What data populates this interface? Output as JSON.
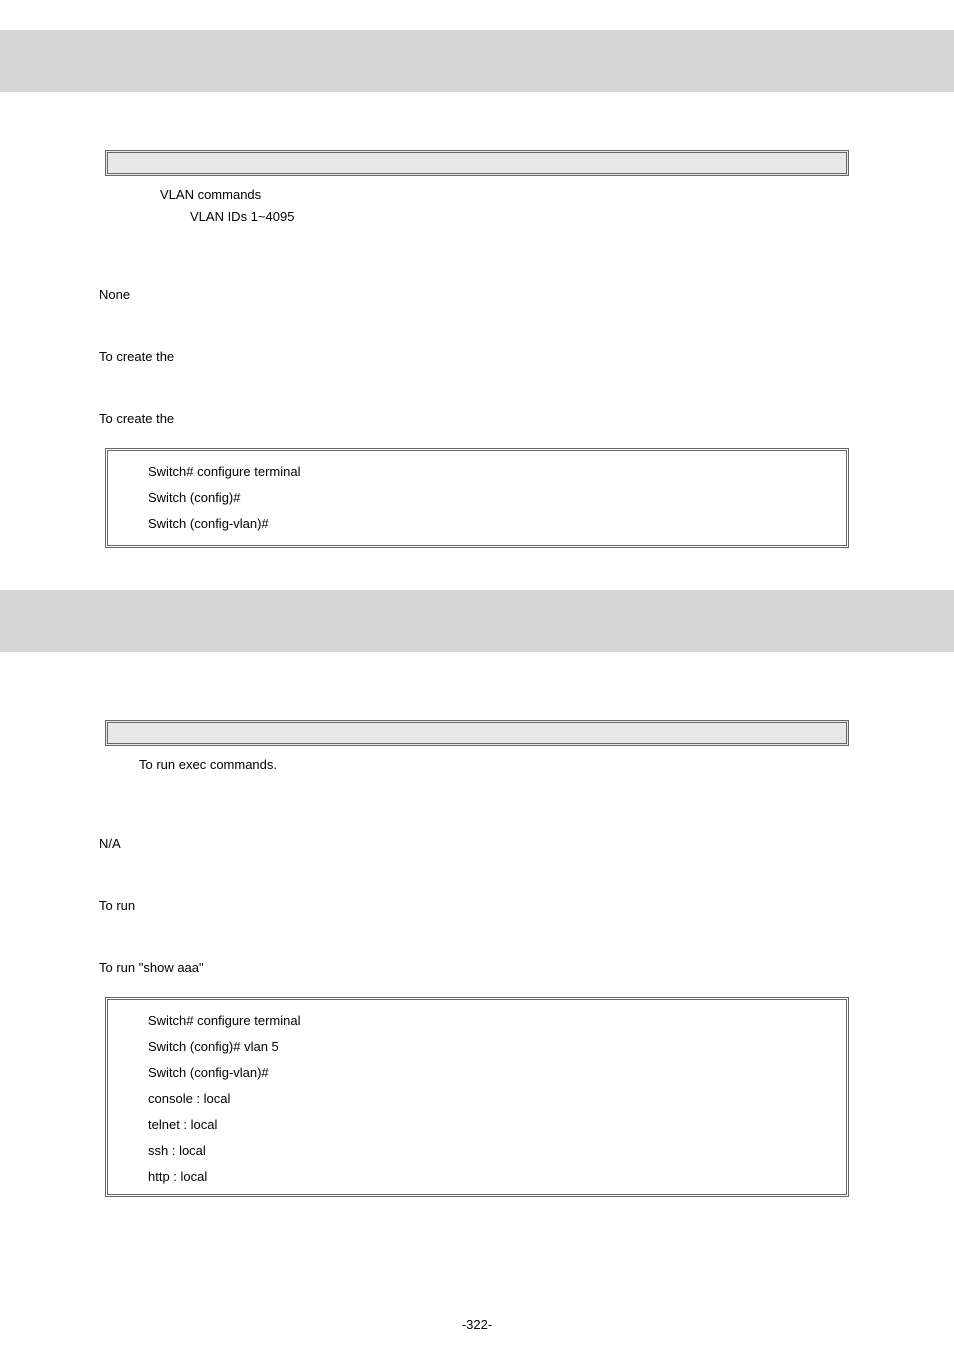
{
  "section1": {
    "param_vlan": "VLAN commands",
    "param_list": "VLAN IDs 1~4095",
    "default": "None",
    "usage": "To create the",
    "example_intro": "To create the",
    "code": {
      "l1": "Switch# configure terminal",
      "l2": "Switch (config)#",
      "l3": "Switch (config-vlan)#"
    }
  },
  "section2": {
    "param_do": "To run exec commands.",
    "default": "N/A",
    "usage": "To run",
    "example_intro": "To run \"show aaa\"",
    "code": {
      "l1": "Switch# configure terminal",
      "l2": "Switch (config)# vlan 5",
      "l3": "Switch (config-vlan)#",
      "l4": "console : local",
      "l5": "telnet  :   local",
      "l6": "ssh         : local",
      "l7": "http    :    local"
    }
  },
  "page_number": "-322-"
}
